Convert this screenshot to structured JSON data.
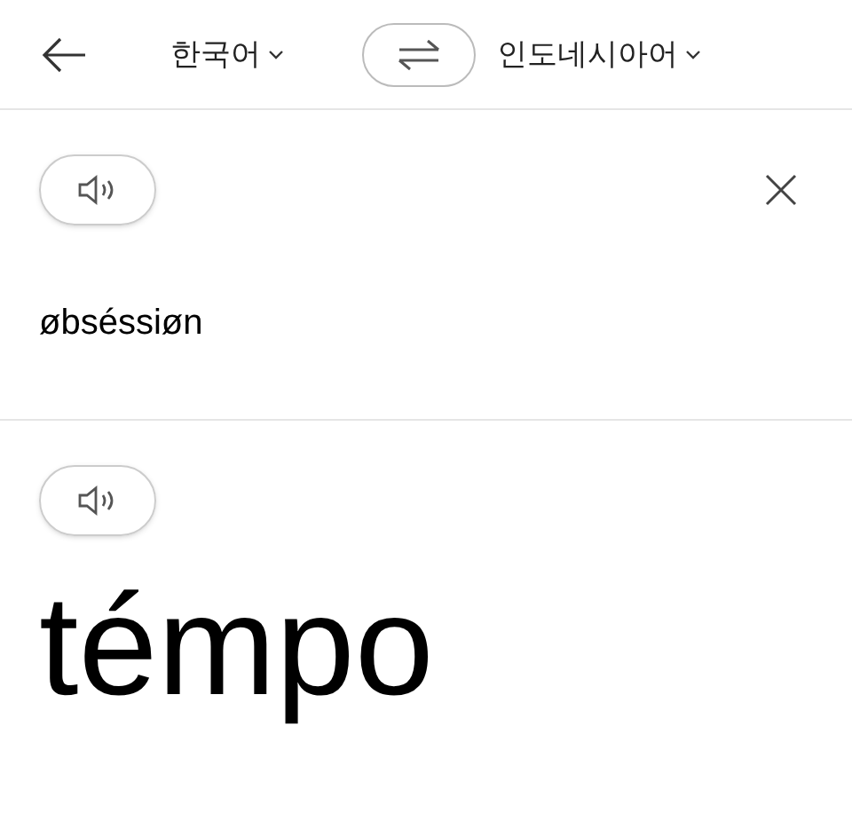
{
  "top_bar": {
    "source_language": "한국어",
    "target_language": "인도네시아어"
  },
  "source": {
    "text": "øbséssiøn"
  },
  "translation": {
    "text": "témpo"
  }
}
